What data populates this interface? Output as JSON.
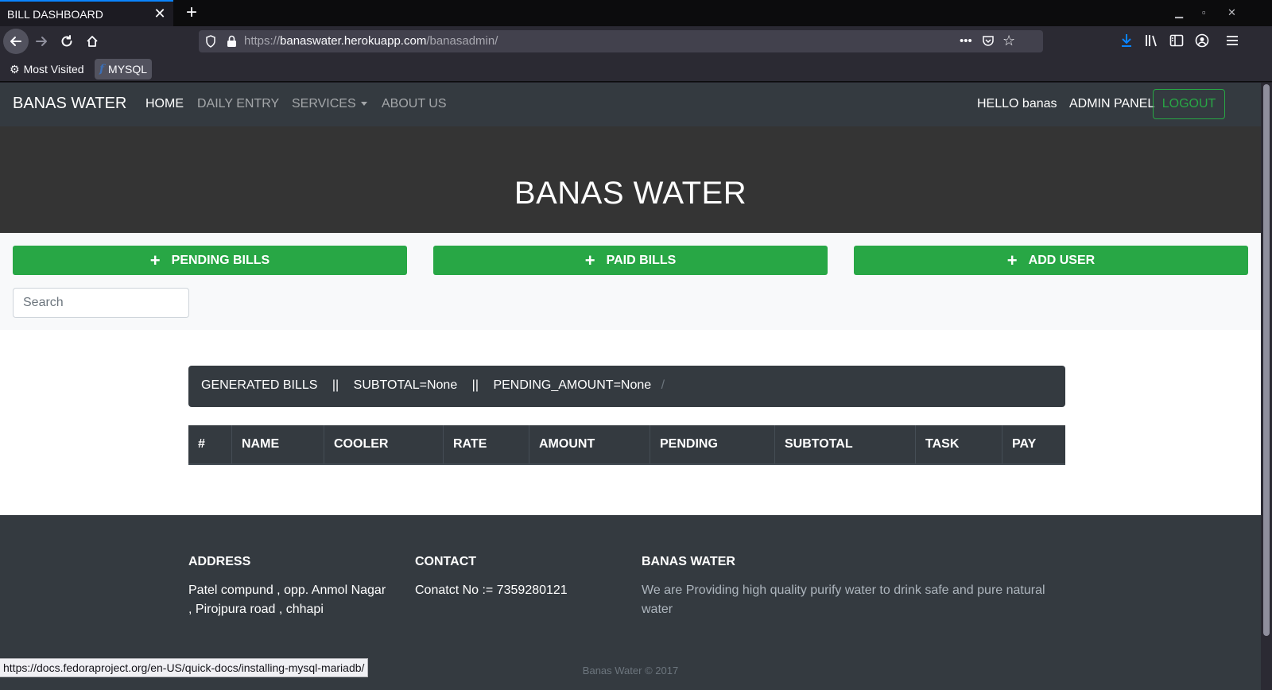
{
  "browser": {
    "tab_title": "BILL DASHBOARD",
    "url_prefix": "https://",
    "url_host": "banaswater.herokuapp.com",
    "url_path": "/banasadmin/",
    "bookmarks": [
      {
        "label": "Most Visited",
        "icon": "gear-icon"
      },
      {
        "label": "MYSQL",
        "icon": "fedora-icon"
      }
    ],
    "status_url": "https://docs.fedoraproject.org/en-US/quick-docs/installing-mysql-mariadb/"
  },
  "nav": {
    "brand": "BANAS WATER",
    "links": [
      "HOME",
      "DAILY ENTRY",
      "SERVICES",
      "ABOUT US"
    ],
    "greeting": "HELLO banas",
    "admin": "ADMIN PANEL",
    "logout": "LOGOUT"
  },
  "hero": {
    "title": "BANAS WATER"
  },
  "actions": {
    "pending": "PENDING BILLS",
    "paid": "PAID BILLS",
    "add_user": "ADD USER",
    "search_placeholder": "Search"
  },
  "summary": {
    "label": "GENERATED BILLS",
    "sep": "||",
    "subtotal": "SUBTOTAL=None",
    "pending": "PENDING_AMOUNT=None",
    "slash": "/"
  },
  "table": {
    "headers": [
      "#",
      "NAME",
      "COOLER",
      "RATE",
      "AMOUNT",
      "PENDING",
      "SUBTOTAL",
      "TASK",
      "PAY"
    ]
  },
  "footer": {
    "address_title": "ADDRESS",
    "address_line1": "Patel compund , opp. Anmol Nagar",
    "address_line2": ", Pirojpura road , chhapi",
    "contact_title": "CONTACT",
    "contact_text": "Conatct No := 7359280121",
    "about_title": "BANAS WATER",
    "about_line1": "We are Providing high quality purify water to drink safe and pure natural",
    "about_line2": "water",
    "copyright": "Banas Water © 2017"
  },
  "colors": {
    "accent_green": "#28a745",
    "navbar_dark": "#343a40",
    "hero_bg": "#343434",
    "browser_accent": "#0a84ff"
  }
}
